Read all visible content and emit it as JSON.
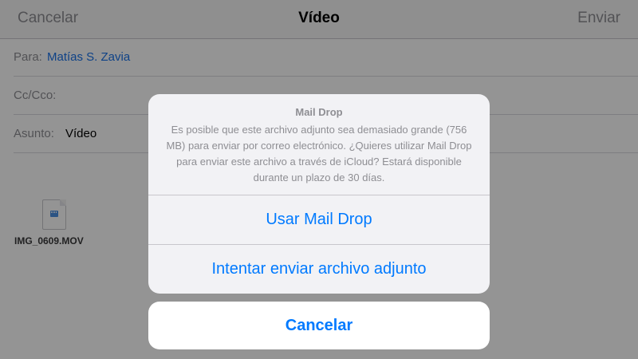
{
  "navbar": {
    "cancel_label": "Cancelar",
    "title": "Vídeo",
    "send_label": "Enviar"
  },
  "fields": {
    "to_label": "Para:",
    "to_value": "Matías S. Zavia",
    "cc_label": "Cc/Cco:",
    "subject_label": "Asunto:",
    "subject_value": "Vídeo"
  },
  "attachment": {
    "icon": "video-file-icon",
    "filename": "IMG_0609.MOV"
  },
  "action_sheet": {
    "title": "Mail Drop",
    "message": "Es posible que este archivo adjunto sea demasiado grande (756 MB) para enviar por correo electrónico. ¿Quieres utilizar Mail Drop para enviar este archivo a través de iCloud? Estará disponible durante un plazo de 30 días.",
    "use_maildrop_label": "Usar Mail Drop",
    "try_attach_label": "Intentar enviar archivo adjunto",
    "cancel_label": "Cancelar"
  },
  "colors": {
    "accent": "#007aff",
    "recipient": "#1a73e8"
  }
}
